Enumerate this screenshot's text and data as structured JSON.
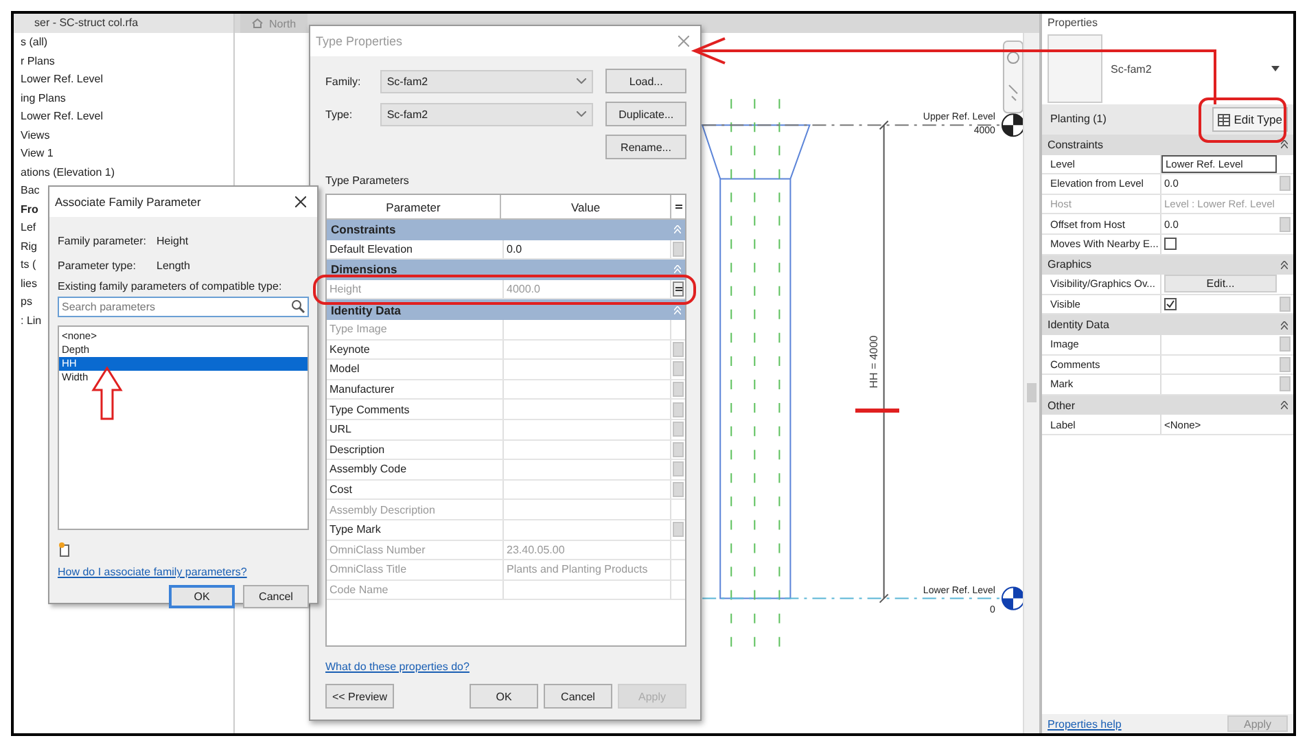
{
  "project_browser": {
    "title": "ser - SC-struct col.rfa",
    "items": [
      {
        "label": "s (all)",
        "selected": false
      },
      {
        "label": "r Plans",
        "selected": false
      },
      {
        "label": "Lower Ref. Level",
        "selected": false
      },
      {
        "label": "ing Plans",
        "selected": false
      },
      {
        "label": "Lower Ref. Level",
        "selected": false
      },
      {
        "label": "Views",
        "selected": false
      },
      {
        "label": "View 1",
        "selected": false
      },
      {
        "label": "ations (Elevation 1)",
        "selected": false
      },
      {
        "label": "Bac",
        "selected": false
      },
      {
        "label": "Fro",
        "selected": true
      },
      {
        "label": "Lef",
        "selected": false
      },
      {
        "label": "Rig",
        "selected": false
      },
      {
        "label": "ts (",
        "selected": false
      },
      {
        "label": "lies",
        "selected": false
      },
      {
        "label": "ps",
        "selected": false
      },
      {
        "label": ": Lin",
        "selected": false
      }
    ]
  },
  "view_tabs": [
    {
      "label": "North"
    }
  ],
  "canvas": {
    "upper_level": {
      "name": "Upper Ref. Level",
      "elevation": "4000"
    },
    "lower_level": {
      "name": "Lower Ref. Level",
      "elevation": "0"
    },
    "dimension": "HH = 4000"
  },
  "properties": {
    "title": "Properties",
    "type_name": "Sc-fam2",
    "category": "Planting (1)",
    "edit_type": "Edit Type",
    "rows": [
      {
        "kind": "group",
        "label": "Constraints"
      },
      {
        "kind": "text",
        "label": "Level",
        "value": "Lower Ref. Level",
        "focused": true,
        "disabled": false,
        "param_button": false
      },
      {
        "kind": "text",
        "label": "Elevation from Level",
        "value": "0.0",
        "focused": false,
        "disabled": false,
        "param_button": true
      },
      {
        "kind": "text",
        "label": "Host",
        "value": "Level : Lower Ref. Level",
        "focused": false,
        "disabled": true,
        "param_button": false
      },
      {
        "kind": "text",
        "label": "Offset from Host",
        "value": "0.0",
        "focused": false,
        "disabled": false,
        "param_button": true
      },
      {
        "kind": "checkbox",
        "label": "Moves With Nearby E...",
        "checked": false,
        "param_button": false
      },
      {
        "kind": "group",
        "label": "Graphics"
      },
      {
        "kind": "button",
        "label": "Visibility/Graphics Ov...",
        "button": "Edit...",
        "param_button": false
      },
      {
        "kind": "checkbox",
        "label": "Visible",
        "checked": true,
        "param_button": true
      },
      {
        "kind": "group",
        "label": "Identity Data"
      },
      {
        "kind": "text",
        "label": "Image",
        "focused": false,
        "disabled": false,
        "param_button": true
      },
      {
        "kind": "text",
        "label": "Comments",
        "focused": false,
        "disabled": false,
        "param_button": true
      },
      {
        "kind": "text",
        "label": "Mark",
        "focused": false,
        "disabled": false,
        "param_button": true
      },
      {
        "kind": "group",
        "label": "Other"
      },
      {
        "kind": "text",
        "label": "Label",
        "value": "<None>",
        "focused": false,
        "disabled": false,
        "param_button": false
      }
    ],
    "help_link": "Properties help",
    "apply": "Apply"
  },
  "type_properties": {
    "title": "Type Properties",
    "family_label": "Family:",
    "family": "Sc-fam2",
    "type_label": "Type:",
    "type": "Sc-fam2",
    "load": "Load...",
    "duplicate": "Duplicate...",
    "rename": "Rename...",
    "section": "Type Parameters",
    "columns": [
      "Parameter",
      "Value"
    ],
    "rows": [
      {
        "kind": "group",
        "label": "Constraints"
      },
      {
        "kind": "param",
        "label": "Default Elevation",
        "value": "0.0",
        "disabled": false,
        "param_button": true,
        "associated": false
      },
      {
        "kind": "group",
        "label": "Dimensions"
      },
      {
        "kind": "param",
        "label": "Height",
        "value": "4000.0",
        "disabled": true,
        "param_button": true,
        "associated": true
      },
      {
        "kind": "group",
        "label": "Identity Data"
      },
      {
        "kind": "param",
        "label": "Type Image",
        "disabled": true,
        "param_button": false,
        "associated": false
      },
      {
        "kind": "param",
        "label": "Keynote",
        "disabled": false,
        "param_button": true,
        "associated": false
      },
      {
        "kind": "param",
        "label": "Model",
        "disabled": false,
        "param_button": true,
        "associated": false
      },
      {
        "kind": "param",
        "label": "Manufacturer",
        "disabled": false,
        "param_button": true,
        "associated": false
      },
      {
        "kind": "param",
        "label": "Type Comments",
        "disabled": false,
        "param_button": true,
        "associated": false
      },
      {
        "kind": "param",
        "label": "URL",
        "disabled": false,
        "param_button": true,
        "associated": false
      },
      {
        "kind": "param",
        "label": "Description",
        "disabled": false,
        "param_button": true,
        "associated": false
      },
      {
        "kind": "param",
        "label": "Assembly Code",
        "disabled": false,
        "param_button": true,
        "associated": false
      },
      {
        "kind": "param",
        "label": "Cost",
        "disabled": false,
        "param_button": true,
        "associated": false
      },
      {
        "kind": "param",
        "label": "Assembly Description",
        "disabled": true,
        "param_button": false,
        "associated": false
      },
      {
        "kind": "param",
        "label": "Type Mark",
        "disabled": false,
        "param_button": true,
        "associated": false
      },
      {
        "kind": "param",
        "label": "OmniClass Number",
        "value": "23.40.05.00",
        "disabled": true,
        "param_button": false,
        "associated": false
      },
      {
        "kind": "param",
        "label": "OmniClass Title",
        "value": "Plants and Planting Products",
        "disabled": true,
        "param_button": false,
        "associated": false
      },
      {
        "kind": "param",
        "label": "Code Name",
        "disabled": true,
        "param_button": false,
        "associated": false
      }
    ],
    "help_link": "What do these properties do?",
    "preview": "<< Preview",
    "actions": [
      {
        "label": "OK",
        "disabled": false
      },
      {
        "label": "Cancel",
        "disabled": false
      },
      {
        "label": "Apply",
        "disabled": true
      }
    ]
  },
  "associate_dialog": {
    "title": "Associate Family Parameter",
    "fields": [
      {
        "label": "Family parameter:",
        "value": "Height"
      },
      {
        "label": "Parameter type:",
        "value": "Length"
      }
    ],
    "list_label": "Existing family parameters of compatible type:",
    "search": {
      "placeholder": "Search parameters"
    },
    "options": [
      {
        "label": "<none>",
        "selected": false
      },
      {
        "label": "Depth",
        "selected": false
      },
      {
        "label": "HH",
        "selected": true
      },
      {
        "label": "Width",
        "selected": false
      }
    ],
    "help_link": "How do I associate family parameters?",
    "buttons": [
      {
        "label": "OK",
        "default": true
      },
      {
        "label": "Cancel",
        "default": false
      }
    ]
  }
}
